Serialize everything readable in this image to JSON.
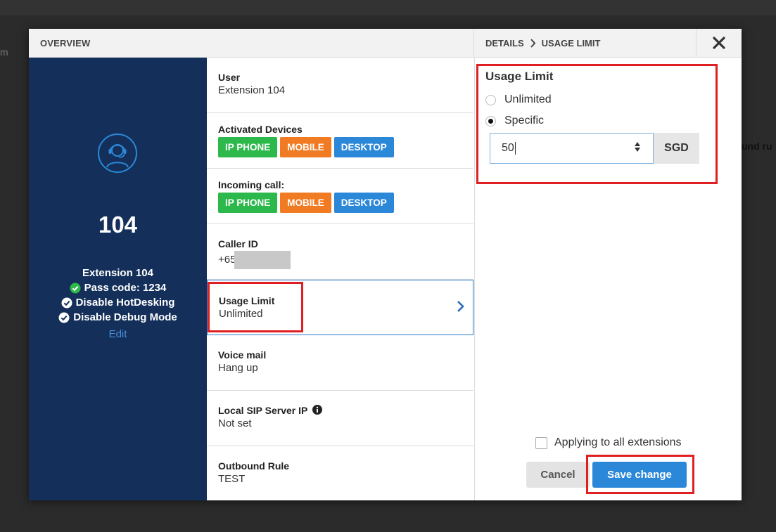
{
  "background": {
    "partial_left": "m",
    "partial_right": "und ru"
  },
  "header": {
    "overview_label": "OVERVIEW",
    "crumb_details": "DETAILS",
    "crumb_current": "USAGE LIMIT"
  },
  "profile": {
    "number": "104",
    "extension": "Extension 104",
    "pass_code": "Pass code: 1234",
    "hotdesking": "Disable HotDesking",
    "debug": "Disable Debug Mode",
    "edit": "Edit"
  },
  "details": {
    "user_label": "User",
    "user_value": "Extension 104",
    "devices_label": "Activated Devices",
    "devices_tags": [
      "IP PHONE",
      "MOBILE",
      "DESKTOP"
    ],
    "incoming_label": "Incoming call:",
    "incoming_tags": [
      "IP PHONE",
      "MOBILE",
      "DESKTOP"
    ],
    "caller_label": "Caller ID",
    "caller_value": "+65",
    "usage_label": "Usage Limit",
    "usage_value": "Unlimited",
    "voicemail_label": "Voice mail",
    "voicemail_value": "Hang up",
    "sip_label": "Local SIP Server IP",
    "sip_value": "Not set",
    "outbound_label": "Outbound Rule",
    "outbound_value": "TEST"
  },
  "usage_form": {
    "title": "Usage Limit",
    "option_unlimited": "Unlimited",
    "option_specific": "Specific",
    "selected": "Specific",
    "amount": "50",
    "unit": "SGD",
    "apply_all": "Applying to all extensions",
    "cancel": "Cancel",
    "save": "Save change"
  },
  "colors": {
    "panel_blue": "#14305a",
    "tag_green": "#2db84b",
    "tag_orange": "#f07b22",
    "tag_blue": "#2b87d8",
    "highlight_red": "#e02020",
    "check_green": "#2db84b"
  }
}
